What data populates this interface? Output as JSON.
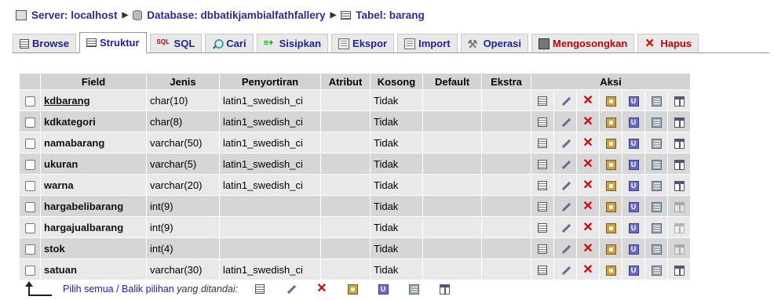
{
  "breadcrumb": {
    "server": "Server: localhost",
    "database": "Database: dbbatikjambialfathfallery",
    "table": "Tabel: barang"
  },
  "tabs": [
    {
      "label": "Browse",
      "icon": "browse-icon"
    },
    {
      "label": "Struktur",
      "icon": "structure-icon",
      "active": true
    },
    {
      "label": "SQL",
      "icon": "sql-icon"
    },
    {
      "label": "Cari",
      "icon": "search-icon"
    },
    {
      "label": "Sisipkan",
      "icon": "insert-icon"
    },
    {
      "label": "Ekspor",
      "icon": "export-icon"
    },
    {
      "label": "Import",
      "icon": "import-icon"
    },
    {
      "label": "Operasi",
      "icon": "operations-icon"
    },
    {
      "label": "Mengosongkan",
      "icon": "empty-icon"
    },
    {
      "label": "Hapus",
      "icon": "drop-icon"
    }
  ],
  "table": {
    "headers": {
      "field": "Field",
      "jenis": "Jenis",
      "penyortiran": "Penyortiran",
      "atribut": "Atribut",
      "kosong": "Kosong",
      "default": "Default",
      "ekstra": "Ekstra",
      "aksi": "Aksi"
    },
    "rows": [
      {
        "field": "kdbarang",
        "jenis": "char(10)",
        "penyortiran": "latin1_swedish_ci",
        "atribut": "",
        "kosong": "Tidak",
        "default": "",
        "ekstra": ""
      },
      {
        "field": "kdkategori",
        "jenis": "char(8)",
        "penyortiran": "latin1_swedish_ci",
        "atribut": "",
        "kosong": "Tidak",
        "default": "",
        "ekstra": ""
      },
      {
        "field": "namabarang",
        "jenis": "varchar(50)",
        "penyortiran": "latin1_swedish_ci",
        "atribut": "",
        "kosong": "Tidak",
        "default": "",
        "ekstra": ""
      },
      {
        "field": "ukuran",
        "jenis": "varchar(5)",
        "penyortiran": "latin1_swedish_ci",
        "atribut": "",
        "kosong": "Tidak",
        "default": "",
        "ekstra": ""
      },
      {
        "field": "warna",
        "jenis": "varchar(20)",
        "penyortiran": "latin1_swedish_ci",
        "atribut": "",
        "kosong": "Tidak",
        "default": "",
        "ekstra": ""
      },
      {
        "field": "hargabelibarang",
        "jenis": "int(9)",
        "penyortiran": "",
        "atribut": "",
        "kosong": "Tidak",
        "default": "",
        "ekstra": ""
      },
      {
        "field": "hargajualbarang",
        "jenis": "int(9)",
        "penyortiran": "",
        "atribut": "",
        "kosong": "Tidak",
        "default": "",
        "ekstra": ""
      },
      {
        "field": "stok",
        "jenis": "int(4)",
        "penyortiran": "",
        "atribut": "",
        "kosong": "Tidak",
        "default": "",
        "ekstra": ""
      },
      {
        "field": "satuan",
        "jenis": "varchar(30)",
        "penyortiran": "latin1_swedish_ci",
        "atribut": "",
        "kosong": "Tidak",
        "default": "",
        "ekstra": ""
      }
    ]
  },
  "footer": {
    "select_all": "Pilih semua",
    "separator": " / ",
    "invert": "Balik pilihan",
    "with_selected": "yang ditandai:"
  }
}
